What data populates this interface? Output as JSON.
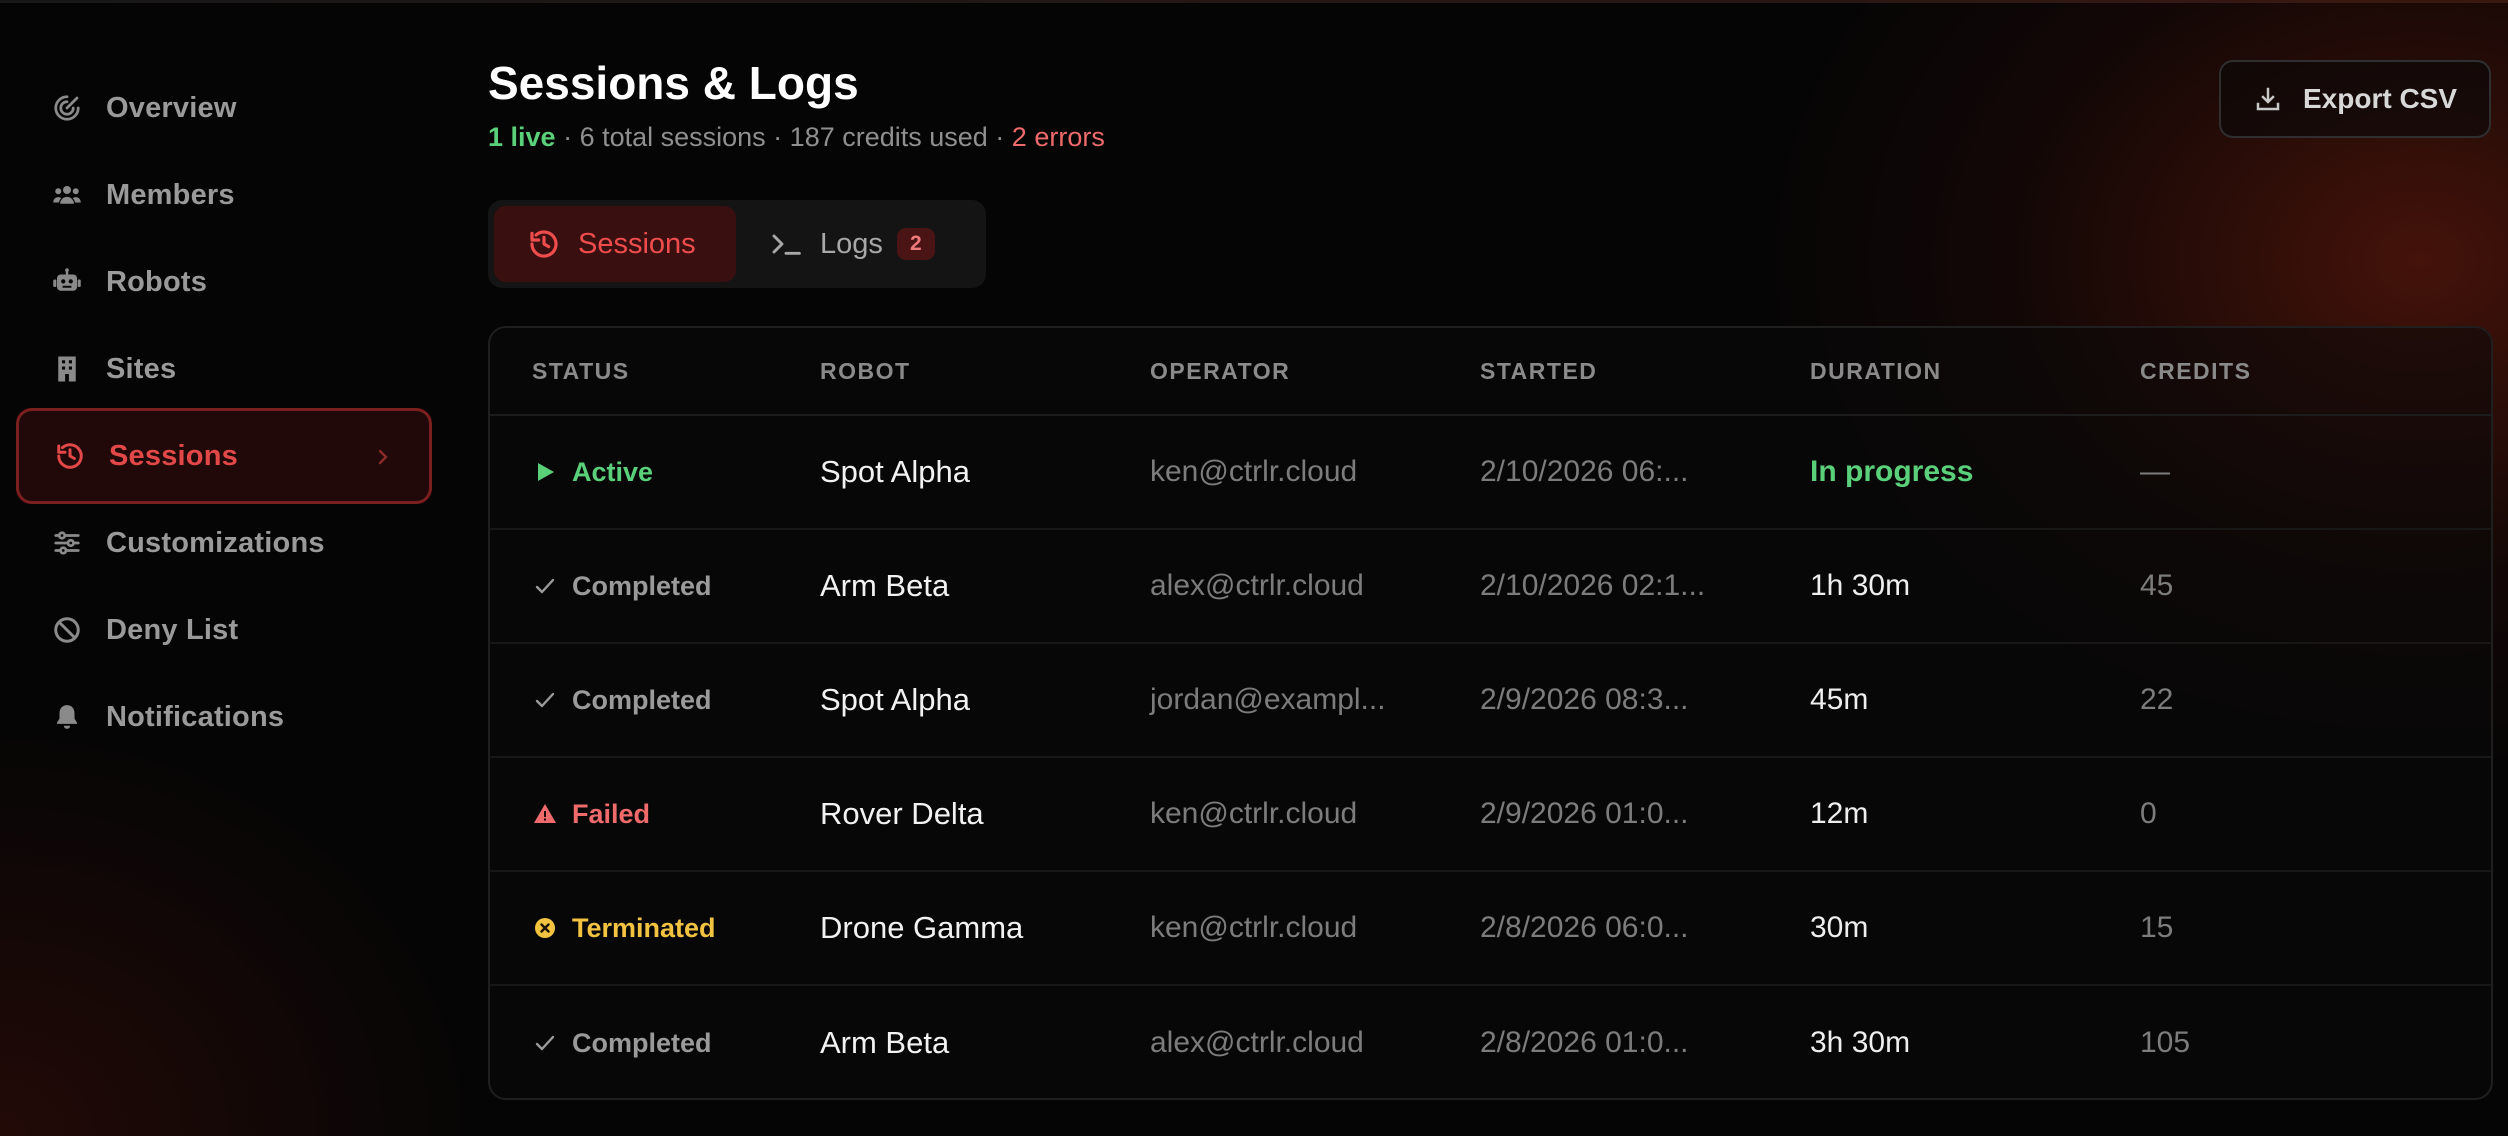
{
  "sidebar": {
    "items": [
      {
        "label": "Overview",
        "icon": "overview-icon",
        "active": false
      },
      {
        "label": "Members",
        "icon": "members-icon",
        "active": false
      },
      {
        "label": "Robots",
        "icon": "robot-icon",
        "active": false
      },
      {
        "label": "Sites",
        "icon": "building-icon",
        "active": false
      },
      {
        "label": "Sessions",
        "icon": "history-icon",
        "active": true
      },
      {
        "label": "Customizations",
        "icon": "sliders-icon",
        "active": false
      },
      {
        "label": "Deny List",
        "icon": "ban-icon",
        "active": false
      },
      {
        "label": "Notifications",
        "icon": "bell-icon",
        "active": false
      }
    ]
  },
  "header": {
    "title": "Sessions & Logs",
    "live": "1 live",
    "sep1": " · ",
    "total": "6 total sessions",
    "sep2": " · ",
    "credits": "187 credits used",
    "sep3": " · ",
    "errors": "2 errors",
    "export_label": "Export CSV"
  },
  "tabs": {
    "sessions_label": "Sessions",
    "logs_label": "Logs",
    "logs_badge": "2"
  },
  "table": {
    "columns": [
      "STATUS",
      "ROBOT",
      "OPERATOR",
      "STARTED",
      "DURATION",
      "CREDITS"
    ],
    "rows": [
      {
        "status": "Active",
        "robot": "Spot Alpha",
        "operator": "ken@ctrlr.cloud",
        "started": "2/10/2026 06:...",
        "duration": "In progress",
        "credits": "—"
      },
      {
        "status": "Completed",
        "robot": "Arm Beta",
        "operator": "alex@ctrlr.cloud",
        "started": "2/10/2026 02:1...",
        "duration": "1h 30m",
        "credits": "45"
      },
      {
        "status": "Completed",
        "robot": "Spot Alpha",
        "operator": "jordan@exampl...",
        "started": "2/9/2026 08:3...",
        "duration": "45m",
        "credits": "22"
      },
      {
        "status": "Failed",
        "robot": "Rover Delta",
        "operator": "ken@ctrlr.cloud",
        "started": "2/9/2026 01:0...",
        "duration": "12m",
        "credits": "0"
      },
      {
        "status": "Terminated",
        "robot": "Drone Gamma",
        "operator": "ken@ctrlr.cloud",
        "started": "2/8/2026 06:0...",
        "duration": "30m",
        "credits": "15"
      },
      {
        "status": "Completed",
        "robot": "Arm Beta",
        "operator": "alex@ctrlr.cloud",
        "started": "2/8/2026 01:0...",
        "duration": "3h 30m",
        "credits": "105"
      }
    ]
  },
  "colors": {
    "active_green": "#5ad07a",
    "failed_red": "#ef6a6a",
    "terminated_yellow": "#f2c341",
    "accent_red": "#e24848"
  }
}
